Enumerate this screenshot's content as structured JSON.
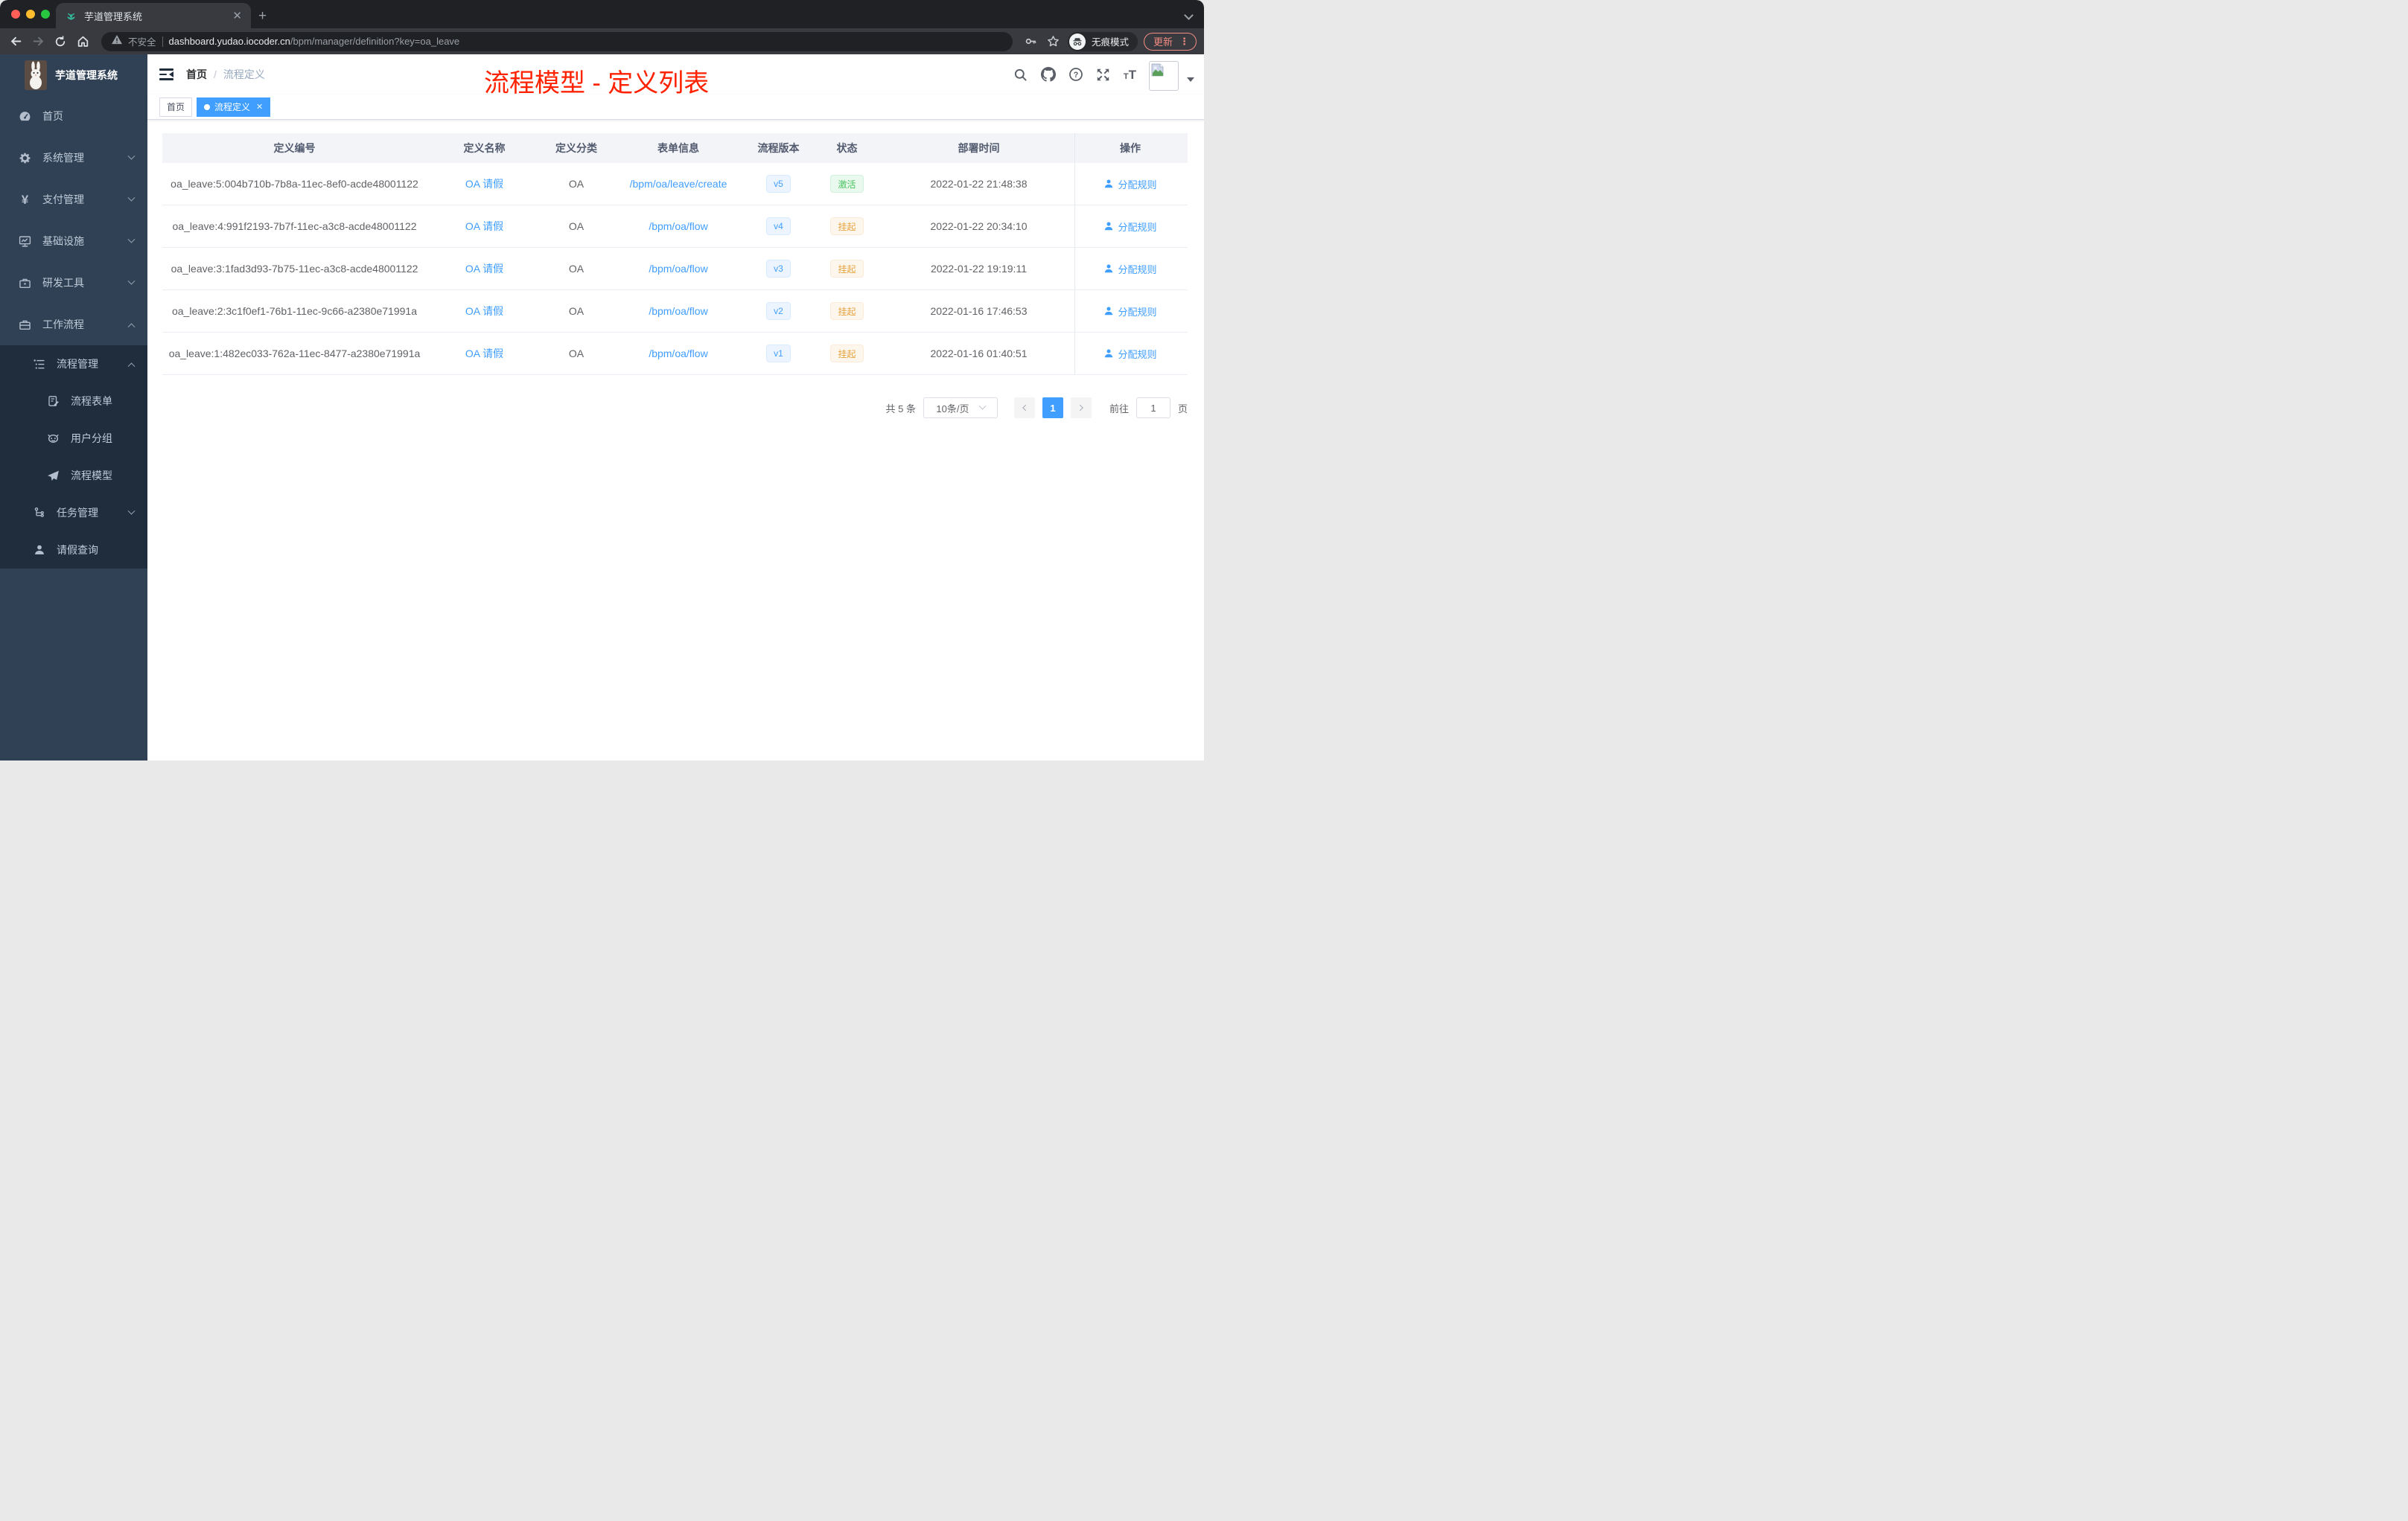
{
  "colors": {
    "accent": "#409eff",
    "annotation_red": "#ff2200",
    "success_green": "#49c35e",
    "warning_orange": "#e6a23c",
    "sidebar_bg": "#304156",
    "submenu_bg": "#1f2d3d"
  },
  "browser": {
    "tab_title": "芋道管理系统",
    "url": {
      "security_label": "不安全",
      "domain": "dashboard.yudao.iocoder.cn",
      "path": "/bpm/manager/definition?key=oa_leave"
    },
    "incognito_label": "无痕模式",
    "update_label": "更新"
  },
  "sidebar": {
    "logo_title": "芋道管理系统",
    "items": [
      {
        "label": "首页"
      },
      {
        "label": "系统管理"
      },
      {
        "label": "支付管理"
      },
      {
        "label": "基础设施"
      },
      {
        "label": "研发工具"
      },
      {
        "label": "工作流程"
      },
      {
        "label": "流程管理"
      },
      {
        "label": "流程表单"
      },
      {
        "label": "用户分组"
      },
      {
        "label": "流程模型"
      },
      {
        "label": "任务管理"
      },
      {
        "label": "请假查询"
      }
    ]
  },
  "header": {
    "breadcrumb": {
      "home": "首页",
      "current": "流程定义"
    },
    "annotation": "流程模型 - 定义列表"
  },
  "tags": {
    "home": "首页",
    "active": "流程定义"
  },
  "table": {
    "columns": [
      "定义编号",
      "定义名称",
      "定义分类",
      "表单信息",
      "流程版本",
      "状态",
      "部署时间",
      "操作"
    ],
    "rows": [
      {
        "id": "oa_leave:5:004b710b-7b8a-11ec-8ef0-acde48001122",
        "name": "OA 请假",
        "category": "OA",
        "form": "/bpm/oa/leave/create",
        "version": "v5",
        "status": "激活",
        "time": "2022-01-22 21:48:38",
        "action": "分配规则"
      },
      {
        "id": "oa_leave:4:991f2193-7b7f-11ec-a3c8-acde48001122",
        "name": "OA 请假",
        "category": "OA",
        "form": "/bpm/oa/flow",
        "version": "v4",
        "status": "挂起",
        "time": "2022-01-22 20:34:10",
        "action": "分配规则"
      },
      {
        "id": "oa_leave:3:1fad3d93-7b75-11ec-a3c8-acde48001122",
        "name": "OA 请假",
        "category": "OA",
        "form": "/bpm/oa/flow",
        "version": "v3",
        "status": "挂起",
        "time": "2022-01-22 19:19:11",
        "action": "分配规则"
      },
      {
        "id": "oa_leave:2:3c1f0ef1-76b1-11ec-9c66-a2380e71991a",
        "name": "OA 请假",
        "category": "OA",
        "form": "/bpm/oa/flow",
        "version": "v2",
        "status": "挂起",
        "time": "2022-01-16 17:46:53",
        "action": "分配规则"
      },
      {
        "id": "oa_leave:1:482ec033-762a-11ec-8477-a2380e71991a",
        "name": "OA 请假",
        "category": "OA",
        "form": "/bpm/oa/flow",
        "version": "v1",
        "status": "挂起",
        "time": "2022-01-16 01:40:51",
        "action": "分配规则"
      }
    ]
  },
  "pagination": {
    "total_label": "共 5 条",
    "page_size": "10条/页",
    "current_page": "1",
    "goto_label": "前往",
    "goto_value": "1",
    "unit_label": "页"
  }
}
